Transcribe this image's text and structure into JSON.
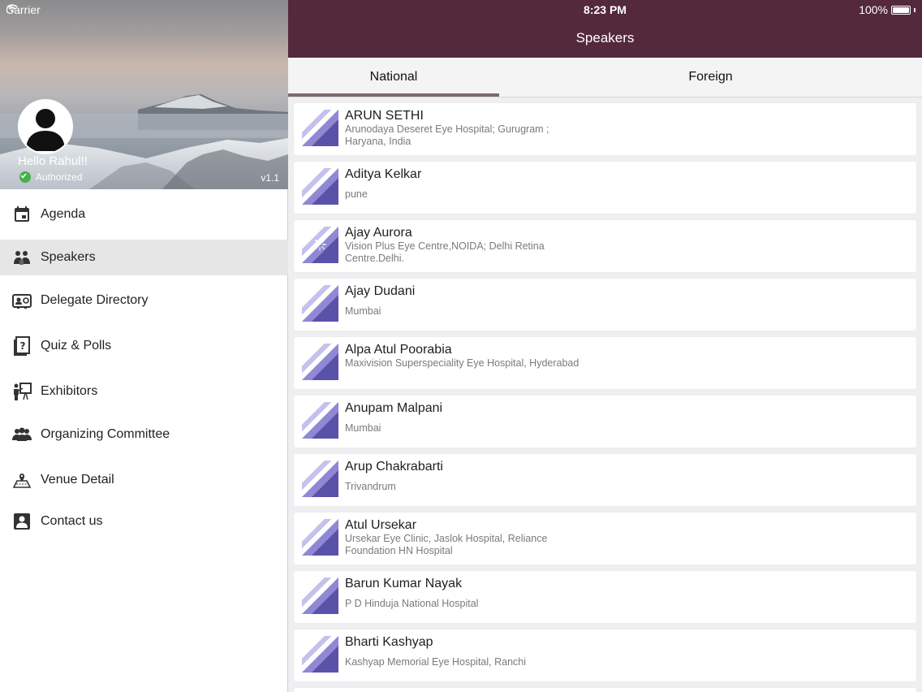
{
  "status": {
    "carrier": "Carrier",
    "time": "8:23 PM",
    "battery": "100%"
  },
  "sidebar": {
    "greeting": "Hello Rahul!!",
    "auth_status": "Authorized",
    "version": "v1.1",
    "items": [
      {
        "label": "Agenda",
        "icon": "calendar-icon"
      },
      {
        "label": "Speakers",
        "icon": "speakers-icon",
        "active": true
      },
      {
        "label": "Delegate Directory",
        "icon": "id-card-icon"
      },
      {
        "label": "Quiz & Polls",
        "icon": "quiz-icon"
      },
      {
        "label": "Exhibitors",
        "icon": "presenter-icon"
      },
      {
        "label": "Organizing Committee",
        "icon": "group-icon"
      },
      {
        "label": "Venue Detail",
        "icon": "map-icon"
      },
      {
        "label": "Contact us",
        "icon": "contact-icon"
      }
    ]
  },
  "header": {
    "title": "Speakers"
  },
  "tabs": [
    {
      "label": "National",
      "selected": true
    },
    {
      "label": "Foreign",
      "selected": false
    }
  ],
  "colors": {
    "header_bg": "#54293c",
    "tab_indicator": "#7a6b70",
    "thumb": "#5a52a8",
    "auth_check": "#43b049"
  },
  "speakers": [
    {
      "name": "ARUN SETHI",
      "affiliation": "Arunodaya Deseret Eye Hospital; Gurugram ; Haryana, India"
    },
    {
      "name": "Aditya Kelkar",
      "affiliation": "pune"
    },
    {
      "name": "Ajay Aurora",
      "affiliation": "Vision Plus Eye Centre,NOIDA; Delhi Retina Centre.Delhi.",
      "loading": true
    },
    {
      "name": "Ajay Dudani",
      "affiliation": "Mumbai"
    },
    {
      "name": "Alpa Atul Poorabia",
      "affiliation": "Maxivision Superspeciality Eye Hospital, Hyderabad"
    },
    {
      "name": "Anupam Malpani",
      "affiliation": "Mumbai"
    },
    {
      "name": "Arup Chakrabarti",
      "affiliation": "Trivandrum"
    },
    {
      "name": "Atul Ursekar",
      "affiliation": "Ursekar Eye Clinic, Jaslok Hospital, Reliance Foundation HN Hospital"
    },
    {
      "name": "Barun Kumar Nayak",
      "affiliation": "P D Hinduja National Hospital"
    },
    {
      "name": "Bharti Kashyap",
      "affiliation": "Kashyap Memorial Eye Hospital, Ranchi"
    }
  ]
}
